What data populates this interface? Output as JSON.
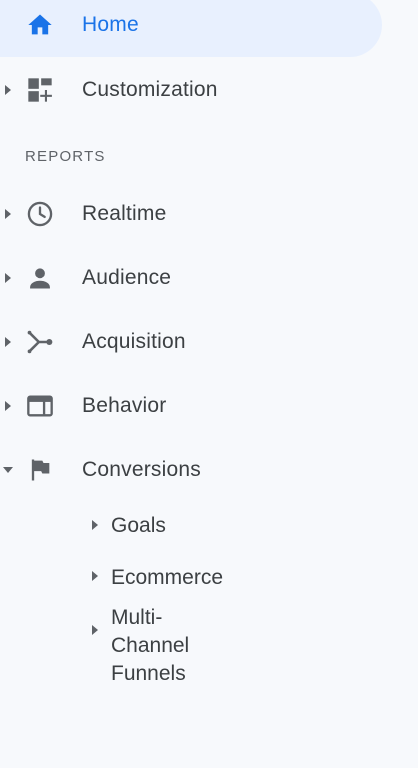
{
  "nav": {
    "home": {
      "label": "Home",
      "icon": "home-icon"
    },
    "customization": {
      "label": "Customization",
      "icon": "dashboard-add-icon"
    },
    "reports_header": "REPORTS",
    "reports": [
      {
        "label": "Realtime",
        "icon": "clock-icon"
      },
      {
        "label": "Audience",
        "icon": "person-icon"
      },
      {
        "label": "Acquisition",
        "icon": "merge-icon"
      },
      {
        "label": "Behavior",
        "icon": "web-layout-icon"
      },
      {
        "label": "Conversions",
        "icon": "flag-icon"
      }
    ],
    "conversions_children": [
      {
        "label": "Goals"
      },
      {
        "label": "Ecommerce"
      },
      {
        "label": "Multi-Channel\nFunnels"
      }
    ]
  },
  "colors": {
    "background": "#f7f9fc",
    "active_bg": "#e8f0fe",
    "active_text": "#1a73e8",
    "text": "#3c4043",
    "icon": "#5f6368"
  }
}
